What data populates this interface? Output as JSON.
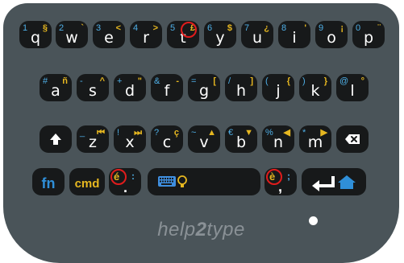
{
  "keyboard": {
    "row1": [
      {
        "main": "q",
        "num": "1",
        "alt": "§"
      },
      {
        "main": "w",
        "num": "2",
        "alt": "`"
      },
      {
        "main": "e",
        "num": "3",
        "alt": "<"
      },
      {
        "main": "r",
        "num": "4",
        "alt": ">"
      },
      {
        "main": "t",
        "num": "5",
        "alt": "£"
      },
      {
        "main": "y",
        "num": "6",
        "alt": "$"
      },
      {
        "main": "u",
        "num": "7",
        "alt": "¿"
      },
      {
        "main": "i",
        "num": "8",
        "alt": "'"
      },
      {
        "main": "o",
        "num": "9",
        "alt": "¡"
      },
      {
        "main": "p",
        "num": "0",
        "alt": "¨"
      }
    ],
    "row2": [
      {
        "main": "a",
        "num": "#",
        "alt": "ñ"
      },
      {
        "main": "s",
        "num": "-",
        "alt": "^"
      },
      {
        "main": "d",
        "num": "+",
        "alt": "\""
      },
      {
        "main": "f",
        "num": "&",
        "alt": "-"
      },
      {
        "main": "g",
        "num": "=",
        "alt": "["
      },
      {
        "main": "h",
        "num": "/",
        "alt": "]"
      },
      {
        "main": "j",
        "num": "(",
        "alt": "{"
      },
      {
        "main": "k",
        "num": ")",
        "alt": "}"
      },
      {
        "main": "l",
        "num": "@",
        "alt": "°"
      }
    ],
    "row3": [
      {
        "main": "z",
        "num": "_",
        "alt": "⏮"
      },
      {
        "main": "x",
        "num": "!",
        "alt": "⏭"
      },
      {
        "main": "c",
        "num": "?",
        "alt": "ç"
      },
      {
        "main": "v",
        "num": "~",
        "alt": "▲"
      },
      {
        "main": "b",
        "num": "€",
        "alt": "▼"
      },
      {
        "main": "n",
        "num": "%",
        "alt": "◀"
      },
      {
        "main": "m",
        "num": "*",
        "alt": "▶"
      }
    ],
    "row4": {
      "fn": "fn",
      "cmd": "cmd",
      "key_e_acute": {
        "main": ".",
        "alt": "é",
        "side": ":"
      },
      "key_e_grave": {
        "main": ",",
        "alt": "è",
        "side": ";"
      }
    },
    "icons": {
      "shift": "arrow-up-icon",
      "delete": "backspace-icon",
      "space": "keyboard-lightbulb-icon",
      "enter": "enter-home-icon"
    },
    "colors": {
      "body": "#4a5459",
      "key": "#17191a",
      "number": "#4fb0e8",
      "alt": "#e6b720",
      "highlight": "#e01c1c"
    }
  },
  "brand": {
    "prefix": "help",
    "number": "2",
    "suffix": "type"
  }
}
